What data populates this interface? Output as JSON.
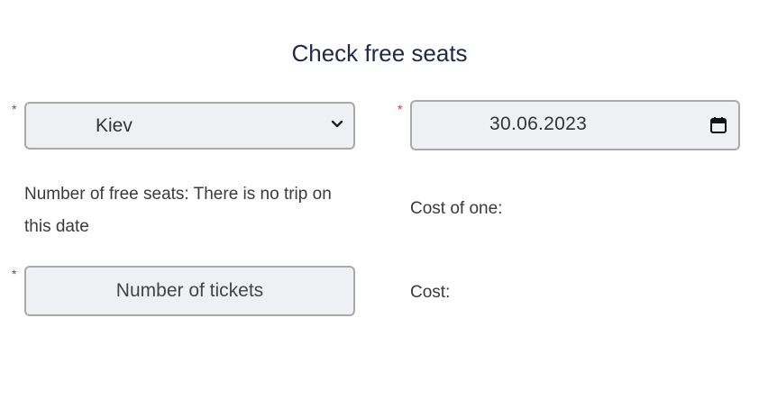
{
  "title": "Check free seats",
  "required_mark": "*",
  "colors": {
    "required_default": "#555555",
    "required_red": "#e0302a"
  },
  "city_select": {
    "selected": "Kiev",
    "icon": "chevron-down-icon"
  },
  "date_input": {
    "value": "30.06.2023",
    "icon": "calendar-icon"
  },
  "free_seats": {
    "text": "Number of free seats: There is no trip on this date"
  },
  "tickets_input": {
    "placeholder": "Number of tickets"
  },
  "cost_of_one": {
    "label": "Cost of one:"
  },
  "cost": {
    "label": "Cost:"
  }
}
